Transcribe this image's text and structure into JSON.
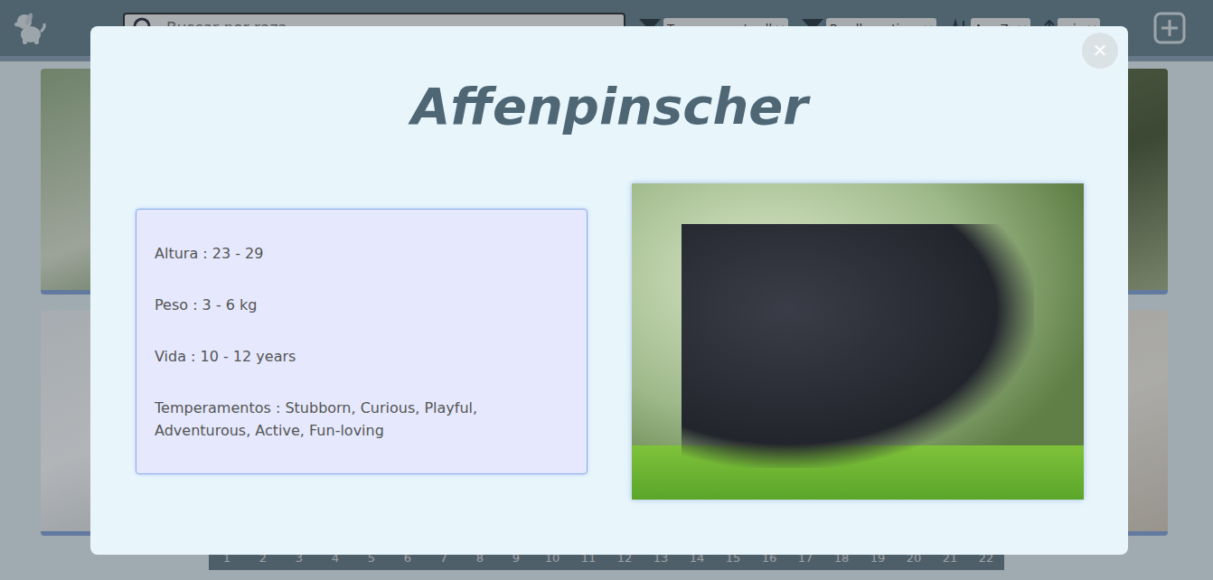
{
  "header": {
    "search": {
      "placeholder": "Buscar por raza"
    },
    "filters": [
      {
        "label": "Temperaments all"
      },
      {
        "label": "By all creations"
      }
    ],
    "sort": {
      "label": "Az - Zz"
    },
    "order": {
      "label": "min"
    }
  },
  "modal": {
    "title": "Affenpinscher",
    "close": "✕",
    "details": [
      "Altura : 23 - 29",
      "Peso : 3 - 6 kg",
      "Vida : 10 - 12 years",
      "Temperamentos : Stubborn, Curious, Playful, Adventurous, Active, Fun-loving"
    ]
  },
  "pagination": {
    "pages": [
      "1",
      "2",
      "3",
      "4",
      "5",
      "6",
      "7",
      "8",
      "9",
      "10",
      "11",
      "12",
      "13",
      "14",
      "15",
      "16",
      "17",
      "18",
      "19",
      "20",
      "21",
      "22"
    ]
  }
}
